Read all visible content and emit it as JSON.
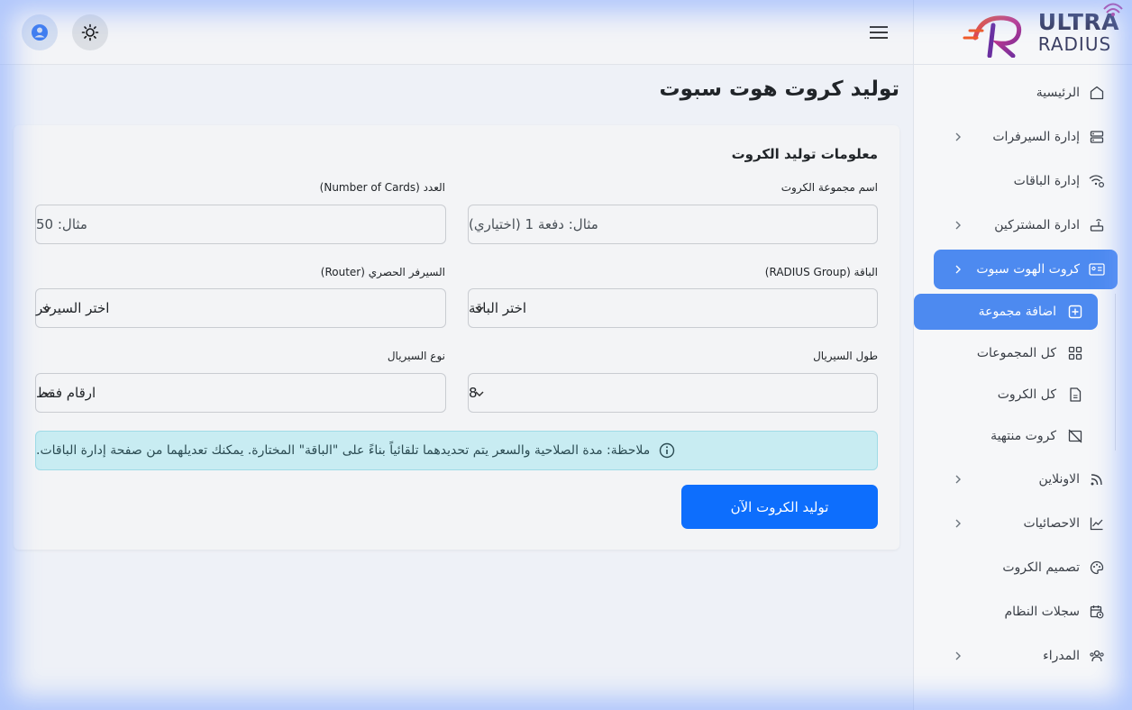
{
  "brand": {
    "line1": "ULTRA",
    "line2": "RADIUS"
  },
  "colors": {
    "primary": "#0d6efd",
    "sidebar_active": "#4d8af0",
    "alert_bg": "#c8ecf2"
  },
  "sidebar": {
    "items": [
      {
        "label": "الرئيسية",
        "icon": "home-icon"
      },
      {
        "label": "إدارة السيرفرات",
        "icon": "server-icon",
        "chevron": true
      },
      {
        "label": "إدارة الباقات",
        "icon": "wifi-settings-icon"
      },
      {
        "label": "ادارة المشتركين",
        "icon": "router-icon",
        "chevron": true
      },
      {
        "label": "كروت الهوت سبوت",
        "icon": "id-card-icon",
        "chevron": true,
        "active": true
      },
      {
        "label": "الاونلاين",
        "icon": "rss-icon",
        "chevron": true
      },
      {
        "label": "الاحصائيات",
        "icon": "chart-line-icon",
        "chevron": true
      },
      {
        "label": "تصميم الكروت",
        "icon": "palette-icon"
      },
      {
        "label": "سجلات النظام",
        "icon": "calendar-clock-icon"
      },
      {
        "label": "المدراء",
        "icon": "users-icon",
        "chevron": true
      }
    ],
    "sub_items": [
      {
        "label": "اضافة مجموعة",
        "icon": "plus-square-icon",
        "active": true
      },
      {
        "label": "كل المجموعات",
        "icon": "grid-icon"
      },
      {
        "label": "كل الكروت",
        "icon": "file-icon"
      },
      {
        "label": "كروت منتهية",
        "icon": "image-off-icon"
      }
    ]
  },
  "page": {
    "title": "توليد كروت هوت سبوت"
  },
  "form": {
    "title": "معلومات توليد الكروت",
    "group_name": {
      "label": "اسم مجموعة الكروت",
      "placeholder": "مثال: دفعة 1 (اختياري)"
    },
    "count": {
      "label": "العدد (Number of Cards)",
      "placeholder": "مثال: 50"
    },
    "package": {
      "label": "الباقة (RADIUS Group)",
      "value": "اختر الباقة"
    },
    "router": {
      "label": "السيرفر الحصري (Router)",
      "value": "اختر السيرفر"
    },
    "serial_length": {
      "label": "طول السيريال",
      "value": "8"
    },
    "serial_type": {
      "label": "نوع السيريال",
      "value": "ارقام فقط"
    },
    "note": "ملاحظة: مدة الصلاحية والسعر يتم تحديدهما تلقائياً بناءً على \"الباقة\" المختارة. يمكنك تعديلهما من صفحة إدارة الباقات.",
    "submit_label": "توليد الكروت الآن"
  }
}
